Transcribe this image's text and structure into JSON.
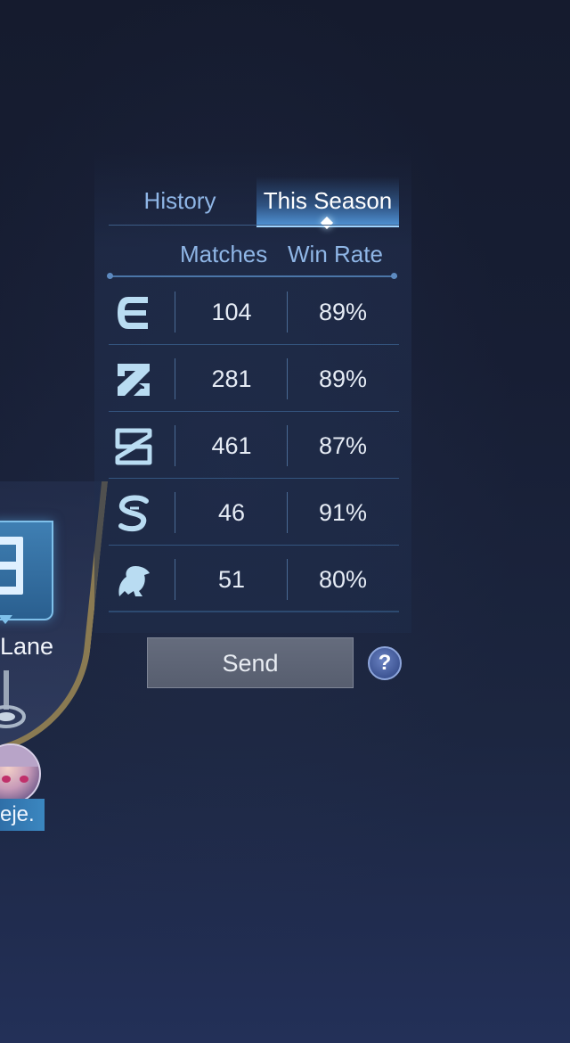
{
  "tabs": {
    "history": "History",
    "this_season": "This Season"
  },
  "columns": {
    "matches": "Matches",
    "win_rate": "Win Rate"
  },
  "rows": [
    {
      "icon": "lane-e-icon",
      "matches": "104",
      "win_rate": "89%"
    },
    {
      "icon": "lane-slash-icon",
      "matches": "281",
      "win_rate": "89%"
    },
    {
      "icon": "lane-z-icon",
      "matches": "461",
      "win_rate": "87%"
    },
    {
      "icon": "lane-s-icon",
      "matches": "46",
      "win_rate": "91%"
    },
    {
      "icon": "lane-beast-icon",
      "matches": "51",
      "win_rate": "80%"
    }
  ],
  "send_label": "Send",
  "help_label": "?",
  "lane": {
    "label": "Lane",
    "icon": "lane-e-icon"
  },
  "player": {
    "name": "eje."
  },
  "colors": {
    "active_tab": "#4e8fd0",
    "tab_text": "#8fb6e6",
    "button": "#5f6677"
  }
}
